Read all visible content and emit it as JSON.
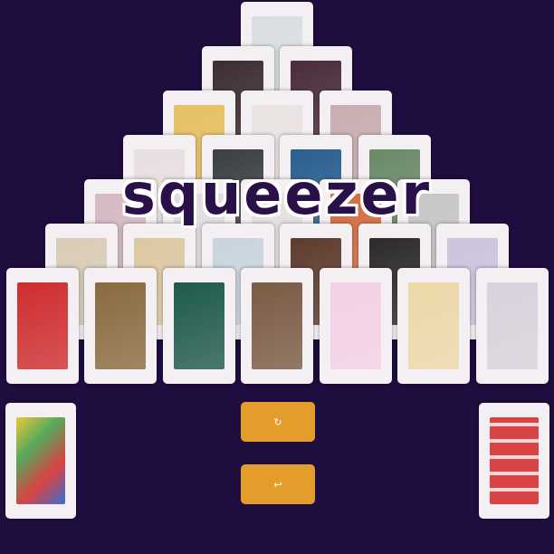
{
  "title": "squeezer",
  "buttons": {
    "hint_label": "↻",
    "undo_label": "↩"
  },
  "colors": {
    "background": "#200d40",
    "button": "#e39d2a",
    "card_border": "#f4eff2"
  },
  "pyramid_rows": [
    [
      "#d9dfe0"
    ],
    [
      "#3c2d33",
      "#4a2c3a"
    ],
    [
      "#e6c062",
      "#eae3e1",
      "#c8aeb0"
    ],
    [
      "#e7dfe0",
      "#3b3f43",
      "#2a5f8f",
      "#6b8a68"
    ],
    [
      "#d5b9c5",
      "#e0dde0",
      "#e4dfe1",
      "#d36b40",
      "#c6c6c7"
    ],
    [
      "#d9ccb7",
      "#dcc9a2",
      "#c9d4df",
      "#5d3c2d",
      "#2c2a2c",
      "#cbc4dc"
    ],
    [
      "#cf2d2f",
      "#8a6b3f",
      "#1f5b4a",
      "#7a5b44",
      "#f3d1e5",
      "#ecd9a8",
      "#d9d2dc"
    ]
  ],
  "stock_pile": {
    "art": "#56a85a",
    "suit": "♥"
  },
  "waste_pile": {
    "art": "#d94343",
    "suit": "♠"
  }
}
